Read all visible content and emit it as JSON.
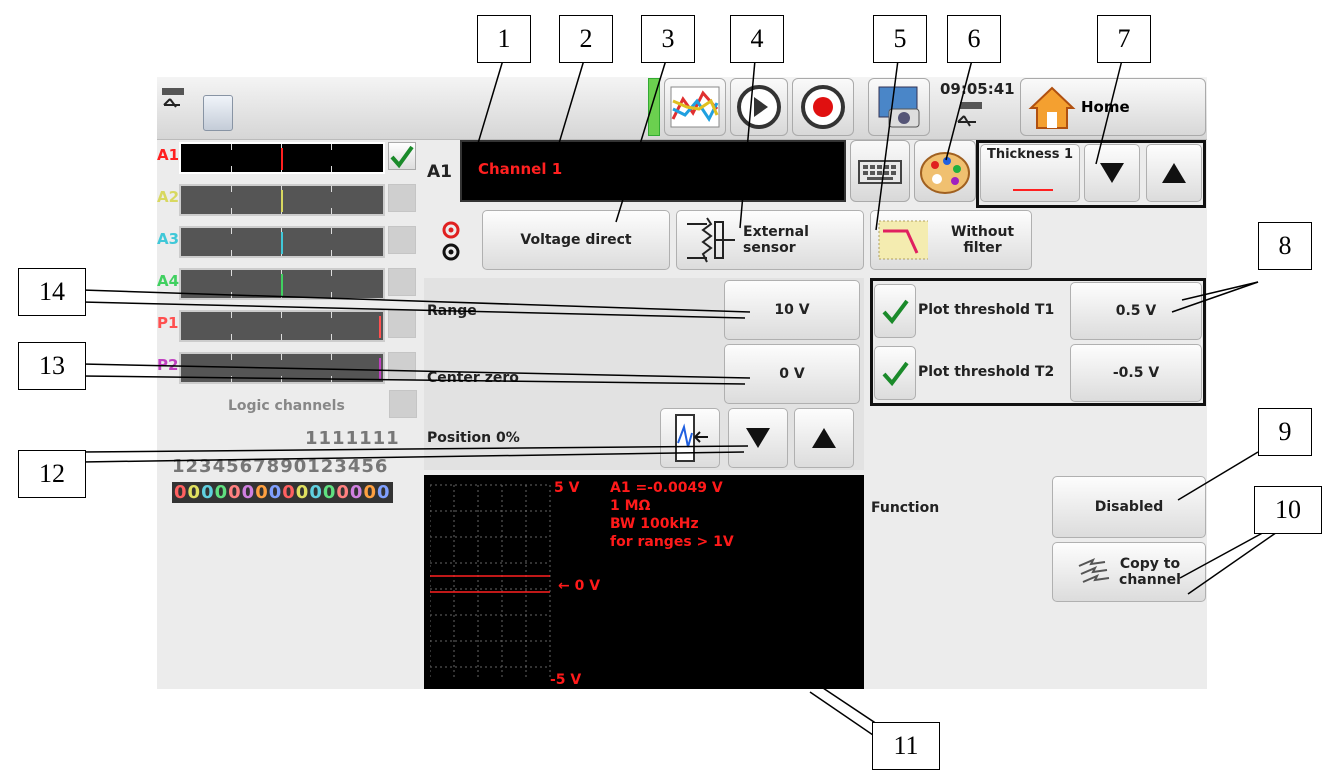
{
  "header": {
    "clock": "09:05:41",
    "home_label": "Home"
  },
  "channels": [
    {
      "name": "A1",
      "color": "#ff2020",
      "checked": true
    },
    {
      "name": "A2",
      "color": "#d8d860",
      "checked": false
    },
    {
      "name": "A3",
      "color": "#40c8d8",
      "checked": false
    },
    {
      "name": "A4",
      "color": "#40d060",
      "checked": false
    },
    {
      "name": "P1",
      "color": "#ff5050",
      "checked": false
    },
    {
      "name": "P2",
      "color": "#c040c0",
      "checked": false
    }
  ],
  "logic": {
    "label": "Logic channels",
    "row1": "1111111",
    "row2": "1234567890123456",
    "row3": "0000000000000000"
  },
  "channel_header": {
    "id": "A1",
    "name_value": "Channel 1"
  },
  "thickness": {
    "label": "Thickness 1"
  },
  "input_modes": {
    "voltage": "Voltage direct",
    "sensor": "External sensor",
    "filter": "Without filter"
  },
  "settings": {
    "range_label": "Range",
    "range_value": "10 V",
    "center_label": "Center zero",
    "center_value": "0 V",
    "position_label": "Position 0%"
  },
  "thresholds": {
    "t1_label": "Plot threshold T1",
    "t1_value": "0.5 V",
    "t2_label": "Plot threshold T2",
    "t2_value": "-0.5 V"
  },
  "preview": {
    "top": "5 V",
    "bottom": "-5 V",
    "zero": "← 0 V",
    "info1": "A1 =-0.0049 V",
    "info2": "1 MΩ",
    "info3": "BW 100kHz",
    "info4": "for ranges > 1V"
  },
  "function": {
    "label": "Function",
    "value": "Disabled",
    "copy": "Copy to channel"
  },
  "callouts": [
    "1",
    "2",
    "3",
    "4",
    "5",
    "6",
    "7",
    "8",
    "9",
    "10",
    "11",
    "12",
    "13",
    "14"
  ],
  "colors": {
    "accent_red": "#ff1a1a",
    "screen_bg": "#ececec"
  }
}
